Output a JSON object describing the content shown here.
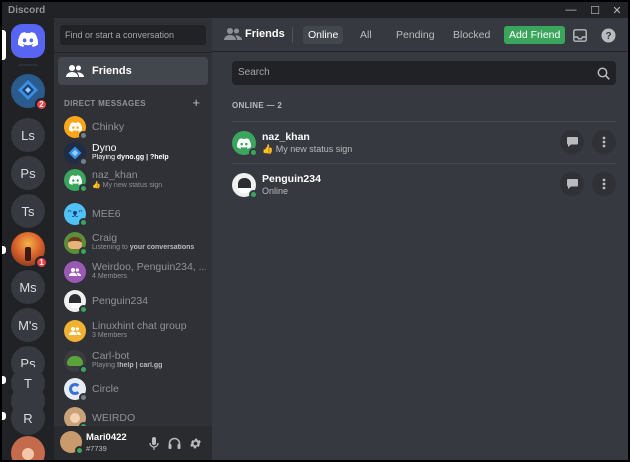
{
  "window": {
    "title": "Discord",
    "controls": [
      "minimize",
      "maximize",
      "close"
    ]
  },
  "colors": {
    "blurple": "#5865f2",
    "online": "#3ba55d",
    "idle": "#faa81a",
    "offline": "#747f8d",
    "badge": "#ed4245"
  },
  "servers": [
    {
      "name": "home",
      "icon": "discord-logo-icon"
    },
    {
      "name": "dyno-server",
      "icon": "dyno-icon",
      "badge": "2"
    },
    {
      "name": "Ls",
      "label": "Ls"
    },
    {
      "name": "Ps",
      "label": "Ps"
    },
    {
      "name": "Ts",
      "label": "Ts"
    },
    {
      "name": "image-server",
      "icon": "sunset-image-icon",
      "badge": "1"
    },
    {
      "name": "Ms",
      "label": "Ms"
    },
    {
      "name": "M's",
      "label": "M's"
    },
    {
      "name": "Ps2",
      "label": "Ps"
    },
    {
      "name": "T",
      "label": "T"
    },
    {
      "name": "R",
      "label": "R"
    },
    {
      "name": "photo-server",
      "icon": "photo-icon"
    }
  ],
  "dm_column": {
    "search_placeholder": "Find or start a conversation",
    "friends_label": "Friends",
    "direct_messages_header": "DIRECT MESSAGES",
    "dms": [
      {
        "name": "Chinky",
        "status": "idle",
        "avatar": "discord-orange"
      },
      {
        "name": "Dyno",
        "status": "offline",
        "sub_prefix": "Playing ",
        "sub_bold": "dyno.gg | ?help",
        "avatar": "dyno"
      },
      {
        "name": "naz_khan",
        "status": "online",
        "sub_plain": "👍 My new status sign",
        "avatar": "discord-green"
      },
      {
        "name": "MEE6",
        "status": "online",
        "avatar": "mee6"
      },
      {
        "name": "Craig",
        "status": "online",
        "sub_prefix": "Listening to ",
        "sub_bold": "your conversations",
        "avatar": "craig"
      },
      {
        "name": "Weirdoo, Penguin234, ...",
        "sub_plain": "4 Members",
        "avatar": "group-purple"
      },
      {
        "name": "Penguin234",
        "status": "online",
        "avatar": "penguin"
      },
      {
        "name": "Linuxhint chat group",
        "sub_plain": "3 Members",
        "avatar": "group-yellow"
      },
      {
        "name": "Carl-bot",
        "status": "online",
        "sub_prefix": "Playing ",
        "sub_bold": "!help | carl.gg",
        "avatar": "carl"
      },
      {
        "name": "Circle",
        "status": "offline",
        "avatar": "circle"
      },
      {
        "name": "WEIRDO",
        "status": "online",
        "avatar": "weirdo"
      }
    ]
  },
  "user_panel": {
    "username": "Mari0422",
    "tag": "#7739"
  },
  "main": {
    "title": "Friends",
    "tabs": [
      {
        "label": "Online",
        "active": true
      },
      {
        "label": "All"
      },
      {
        "label": "Pending"
      },
      {
        "label": "Blocked"
      }
    ],
    "add_friend_label": "Add Friend",
    "search_placeholder": "Search",
    "online_header": "ONLINE — 2",
    "friends": [
      {
        "name": "naz_khan",
        "status_text": "👍 My new status sign",
        "avatar": "discord-green"
      },
      {
        "name": "Penguin234",
        "status_text": "Online",
        "avatar": "penguin"
      }
    ]
  }
}
